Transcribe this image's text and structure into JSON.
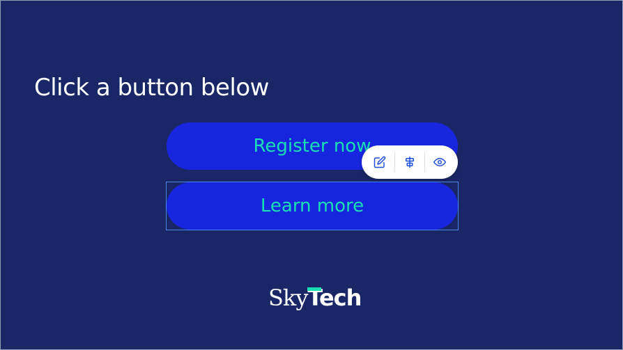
{
  "heading": "Click a button below",
  "buttons": {
    "register_label": "Register now",
    "learn_label": "Learn more"
  },
  "toolbar": {
    "icons": [
      "edit-icon",
      "align-center-icon",
      "eye-icon"
    ]
  },
  "logo": {
    "part1": "Sky",
    "part2": "Tech"
  },
  "colors": {
    "background": "#1a2766",
    "button": "#1726de",
    "button_text": "#19e0b4",
    "selection": "#4a8cff",
    "toolbar_icon": "#1d4ed8"
  }
}
